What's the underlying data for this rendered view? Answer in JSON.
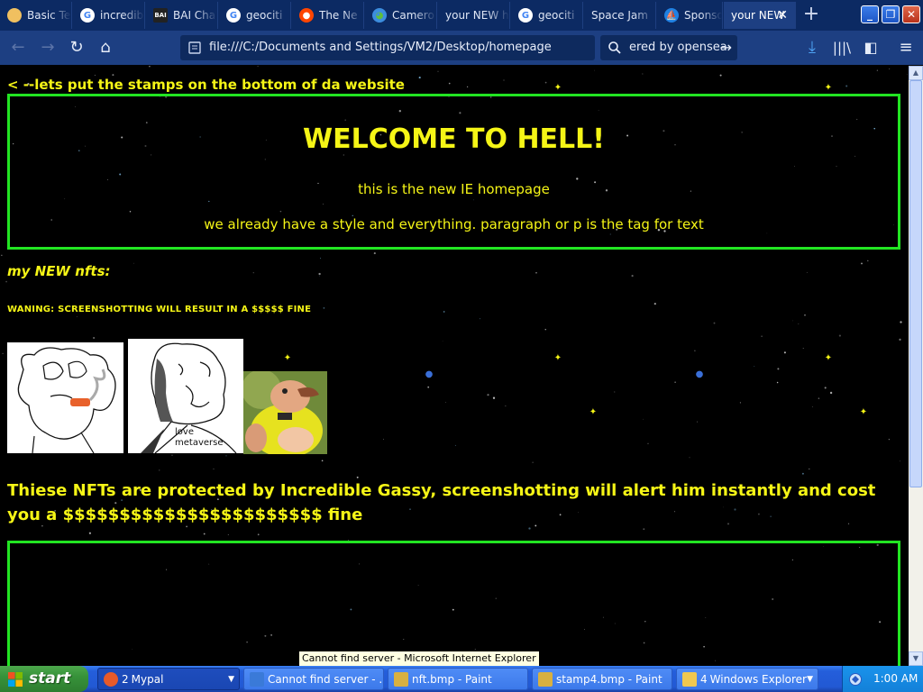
{
  "tabs": [
    {
      "label": "Basic Te",
      "favicon": "circle-icon",
      "fav_color": "#f0c060"
    },
    {
      "label": "incredib",
      "favicon": "google-icon",
      "fav_color": "#ffffff"
    },
    {
      "label": "BAI Cha",
      "favicon": "bai-icon",
      "fav_color": "#222222"
    },
    {
      "label": "geociti",
      "favicon": "google-icon",
      "fav_color": "#ffffff"
    },
    {
      "label": "The Ne",
      "favicon": "reddit-icon",
      "fav_color": "#ff4500"
    },
    {
      "label": "Camero",
      "favicon": "globe-icon",
      "fav_color": "#3c8dde"
    },
    {
      "label": "your NEW h",
      "favicon": "none",
      "fav_color": ""
    },
    {
      "label": "geociti",
      "favicon": "google-icon",
      "fav_color": "#ffffff"
    },
    {
      "label": "Space Jam",
      "favicon": "none",
      "fav_color": ""
    },
    {
      "label": "Sponso",
      "favicon": "opensea-icon",
      "fav_color": "#2081e2"
    },
    {
      "label": "your NEW",
      "favicon": "none",
      "fav_color": "",
      "active": true
    }
  ],
  "navbar": {
    "url": "file:///C:/Documents and Settings/VM2/Desktop/homepage",
    "search_value": "ered by opensea"
  },
  "page": {
    "back_link": "< --lets put the stamps on the bottom of da website",
    "banner_title": "WELCOME TO HELL!",
    "banner_p1": "this is the new IE homepage",
    "banner_p2": "we already have a style and everything. paragraph or p is the tag for text",
    "nft_heading": "my NEW nfts:",
    "warning": "WANING: SCREENSHOTTING WILL RESULT IN A $$$$$ FINE",
    "nft2_caption": "love metaverse",
    "protect_text": "Thiese NFTs are protected by Incredible Gassy, screenshotting will alert him instantly and cost you a $$$$$$$$$$$$$$$$$$$$$$$ fine"
  },
  "tooltip": "Cannot find server - Microsoft Internet Explorer",
  "taskbar": {
    "start_label": "start",
    "tasks": [
      {
        "count": "2",
        "label": "Mypal",
        "icon_color": "#e85a2a",
        "grouped": true,
        "active": true
      },
      {
        "count": "",
        "label": "Cannot find server - ...",
        "icon_color": "#3a7ad8",
        "grouped": false
      },
      {
        "count": "",
        "label": "nft.bmp - Paint",
        "icon_color": "#d8b040",
        "grouped": false
      },
      {
        "count": "",
        "label": "stamp4.bmp - Paint",
        "icon_color": "#d8b040",
        "grouped": false
      },
      {
        "count": "4",
        "label": "Windows Explorer",
        "icon_color": "#f0c850",
        "grouped": true
      }
    ],
    "clock": "1:00 AM"
  },
  "colors": {
    "page_text": "#f5f516",
    "border_green": "#22e522",
    "tab_bar": "#0c2a63",
    "nav_bar": "#1d3f82"
  }
}
